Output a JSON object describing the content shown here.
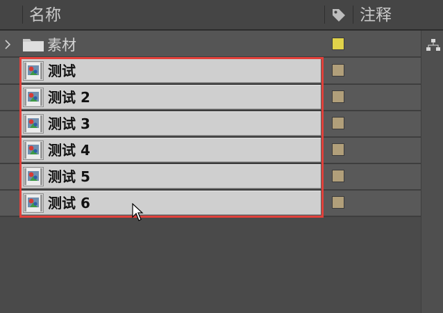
{
  "header": {
    "name_col": "名称",
    "comment_col": "注释",
    "label_icon": "tag-icon"
  },
  "colors": {
    "folder_label": "#e0d24a",
    "item_label": "#b19f7a",
    "selection_border": "#e2403a"
  },
  "folder": {
    "label": "素材",
    "icon": "folder-icon",
    "expand_icon": "chevron-right-icon"
  },
  "items": [
    {
      "label": "测试",
      "icon": "image-footage-icon"
    },
    {
      "label": "测试 2",
      "icon": "image-footage-icon"
    },
    {
      "label": "测试 3",
      "icon": "image-footage-icon"
    },
    {
      "label": "测试 4",
      "icon": "image-footage-icon"
    },
    {
      "label": "测试 5",
      "icon": "image-footage-icon"
    },
    {
      "label": "测试 6",
      "icon": "image-footage-icon"
    }
  ],
  "side_icon": "flowchart-icon"
}
